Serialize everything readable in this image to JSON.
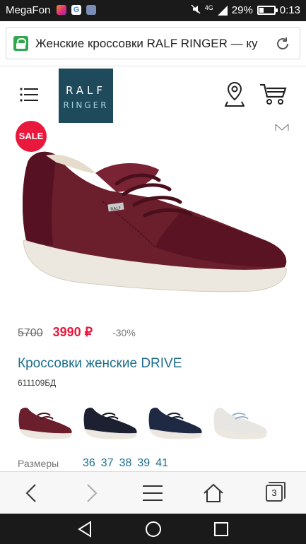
{
  "status_bar": {
    "carrier": "MegaFon",
    "network": "4G",
    "battery": "29%",
    "battery_level": 0.29,
    "time": "0:13"
  },
  "browser": {
    "url_title": "Женские кроссовки RALF RINGER — ку",
    "tab_count": "3"
  },
  "header": {
    "logo_line1": "RALF",
    "logo_line2": "RINGER"
  },
  "product": {
    "badge": "SALE",
    "old_price": "5700",
    "new_price": "3990 ₽",
    "discount": "-30%",
    "title": "Кроссовки женские DRIVE",
    "sku": "611109БД",
    "sizes_label": "Размеры",
    "sizes": [
      "36",
      "37",
      "38",
      "39",
      "41"
    ],
    "tongue_label": "RALF"
  },
  "thumbnails": [
    {
      "color": "#6b1e2c",
      "accent": "#4a0f1c"
    },
    {
      "color": "#1c2030",
      "accent": "#0e111b"
    },
    {
      "color": "#1e2a44",
      "accent": "#111a2e"
    },
    {
      "color": "#e8e6e2",
      "accent": "#9bb0c7"
    }
  ],
  "colors": {
    "accent": "#e8193c",
    "link": "#1d6e8c",
    "logo_bg": "#1f4a5c"
  }
}
